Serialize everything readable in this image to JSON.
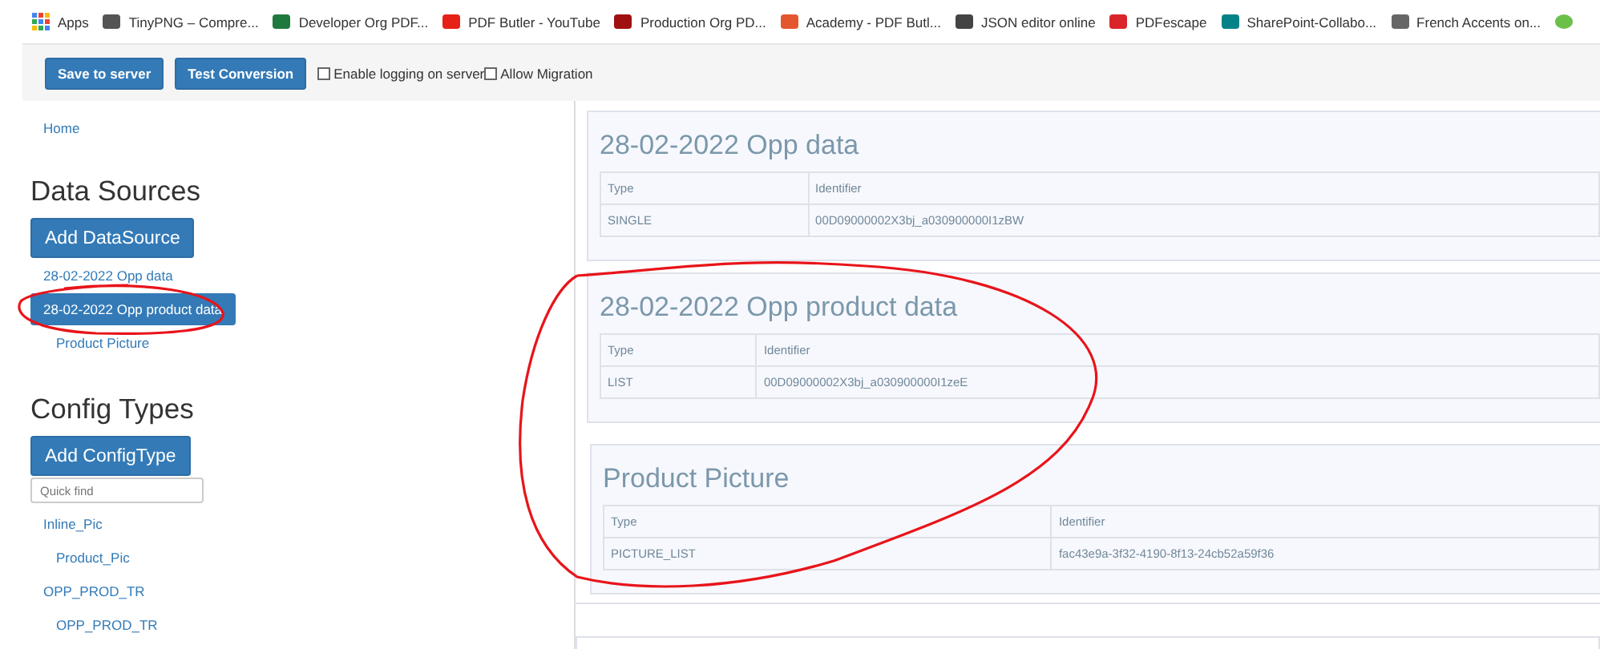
{
  "bookmarks": [
    {
      "label": "Apps",
      "color": "#4285f4"
    },
    {
      "label": "TinyPNG – Compre...",
      "color": "#555555"
    },
    {
      "label": "Developer Org PDF...",
      "color": "#1e7a3c"
    },
    {
      "label": "PDF Butler - YouTube",
      "color": "#e62117"
    },
    {
      "label": "Production Org PD...",
      "color": "#a01010"
    },
    {
      "label": "Academy - PDF Butl...",
      "color": "#e4572e"
    },
    {
      "label": "JSON editor online",
      "color": "#444444"
    },
    {
      "label": "PDFescape",
      "color": "#d9252a"
    },
    {
      "label": "SharePoint-Collabo...",
      "color": "#038387"
    },
    {
      "label": "French Accents on...",
      "color": "#666666"
    }
  ],
  "toolbar": {
    "buttons": [
      "Save to server",
      "Test Conversion"
    ],
    "checkboxes": [
      {
        "label": "Enable logging on server",
        "checked": false
      },
      {
        "label": "Allow Migration",
        "checked": false
      }
    ]
  },
  "sidebar": {
    "home_link": "Home",
    "data_sources": {
      "heading": "Data Sources",
      "add_button": "Add DataSource",
      "items": [
        {
          "label": "28-02-2022 Opp data",
          "selected": false
        },
        {
          "label": "28-02-2022 Opp product data",
          "selected": true,
          "children": [
            {
              "label": "Product Picture",
              "selected": false
            }
          ]
        }
      ]
    },
    "config_types": {
      "heading": "Config Types",
      "add_button": "Add ConfigType",
      "search": {
        "placeholder": "Quick find"
      },
      "items": [
        {
          "label": "Inline_Pic",
          "children": [
            {
              "label": "Product_Pic"
            }
          ]
        },
        {
          "label": "OPP_PROD_TR",
          "children": [
            {
              "label": "OPP_PROD_TR"
            }
          ]
        }
      ]
    }
  },
  "panels": [
    {
      "title": "28-02-2022 Opp data",
      "columns": [
        "Type",
        "Identifier"
      ],
      "rows": [
        [
          "SINGLE",
          "00D09000002X3bj_a030900000I1zBW"
        ]
      ]
    },
    {
      "title": "28-02-2022 Opp product data",
      "columns": [
        "Type",
        "Identifier"
      ],
      "rows": [
        [
          "LIST",
          "00D09000002X3bj_a030900000I1zeE"
        ]
      ],
      "children": [
        {
          "title": "Product Picture",
          "columns": [
            "Type",
            "Identifier"
          ],
          "rows": [
            [
              "PICTURE_LIST",
              "fac43e9a-3f32-4190-8f13-24cb52a59f36"
            ]
          ]
        }
      ]
    }
  ]
}
